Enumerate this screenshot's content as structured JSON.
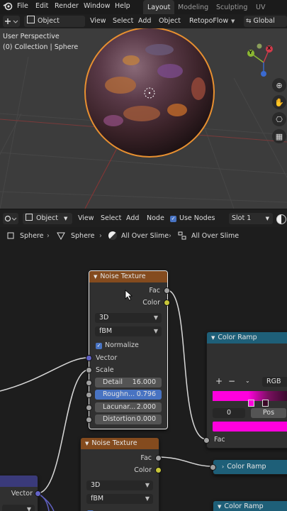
{
  "menubar": {
    "items": [
      "File",
      "Edit",
      "Render",
      "Window",
      "Help"
    ],
    "workspaces": [
      "Layout",
      "Modeling",
      "Sculpting",
      "UV Editing"
    ]
  },
  "viewport_header": {
    "mode": "Object Mode",
    "menus": [
      "View",
      "Select",
      "Add",
      "Object"
    ],
    "addon": "RetopoFlow",
    "orientation": "Global"
  },
  "viewport": {
    "perspective": "User Perspective",
    "collection": "(0) Collection | Sphere",
    "gizmo": {
      "y": "Y",
      "x": "X",
      "z": "Z"
    }
  },
  "node_header": {
    "type": "Object",
    "menus": [
      "View",
      "Select",
      "Add",
      "Node"
    ],
    "use_nodes_label": "Use Nodes",
    "use_nodes_checked": true,
    "slot": "Slot 1"
  },
  "breadcrumb": [
    "Sphere",
    "Sphere",
    "All Over Slime",
    "All Over Slime"
  ],
  "nodes": {
    "noise1": {
      "title": "Noise Texture",
      "outputs": [
        "Fac",
        "Color"
      ],
      "dimensions": "3D",
      "type": "fBM",
      "normalize": "Normalize",
      "inputs": [
        "Vector",
        "Scale"
      ],
      "params": [
        {
          "label": "Detail",
          "value": "16.000"
        },
        {
          "label": "Roughn...",
          "value": "0.796"
        },
        {
          "label": "Lacunar...",
          "value": "2.000"
        },
        {
          "label": "Distortion",
          "value": "0.000"
        }
      ]
    },
    "ramp1": {
      "title": "Color Ramp",
      "mode": "RGB",
      "index": "0",
      "pos": "Pos",
      "input": "Fac",
      "color_accent": "#ff00dd"
    },
    "noise2": {
      "title": "Noise Texture",
      "outputs": [
        "Fac",
        "Color"
      ],
      "dimensions": "3D",
      "type": "fBM"
    },
    "ramp2": {
      "title": "Color Ramp"
    },
    "ramp3": {
      "title": "Color Ramp"
    },
    "left_node": {
      "output": "Vector"
    }
  }
}
